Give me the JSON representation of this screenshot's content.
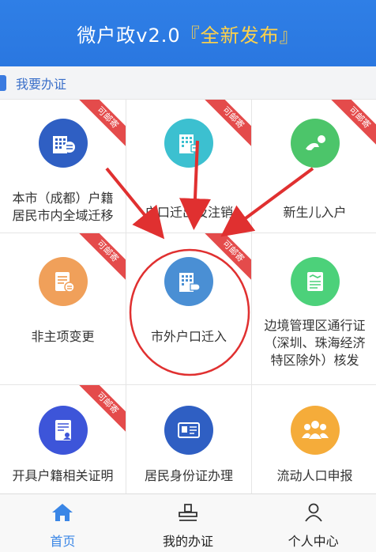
{
  "header": {
    "title_main": "微户政v2.0",
    "title_accent": "『全新发布』"
  },
  "section": {
    "title": "我要办证"
  },
  "services": [
    {
      "label": "本市（成都）户籍居民市内全域迁移",
      "line1": "本市（成都）户籍",
      "line2": "居民市内全域迁移",
      "badge": "可邮寄",
      "icon": "building-transfer-icon",
      "color": "#2f5fc3"
    },
    {
      "label": "户口迁出及注销",
      "badge": "可邮寄",
      "icon": "building-exit-icon",
      "color": "#3cc0d0"
    },
    {
      "label": "新生儿入户",
      "badge": "可邮寄",
      "icon": "baby-crawl-icon",
      "color": "#4cc56a"
    },
    {
      "label": "非主项变更",
      "badge": "可邮寄",
      "icon": "document-edit-icon",
      "color": "#f0a05a"
    },
    {
      "label": "市外户口迁入",
      "badge": "可邮寄",
      "icon": "building-arrive-icon",
      "color": "#4a8fd4"
    },
    {
      "label": "边境管理区通行证（深圳、珠海经济特区除外）核发",
      "line1": "边境管理区通行证",
      "line2": "（深圳、珠海经济",
      "line3": "特区除外）核发",
      "badge": "",
      "icon": "pass-card-icon",
      "color": "#4cd17a"
    },
    {
      "label": "开具户籍相关证明",
      "badge": "可邮寄",
      "icon": "certificate-icon",
      "color": "#3d55d9"
    },
    {
      "label": "居民身份证办理",
      "badge": "",
      "icon": "id-card-icon",
      "color": "#2f5fc3"
    },
    {
      "label": "流动人口申报",
      "badge": "",
      "icon": "people-group-icon",
      "color": "#f5ac3a"
    }
  ],
  "tabs": [
    {
      "label": "首页",
      "icon": "home-icon",
      "active": true
    },
    {
      "label": "我的办证",
      "icon": "stamp-icon",
      "active": false
    },
    {
      "label": "个人中心",
      "icon": "user-icon",
      "active": false
    }
  ],
  "colors": {
    "header_bg": "#2f7fe6",
    "accent_yellow": "#ffd24a",
    "ribbon_red": "#e44b4b",
    "annotation_red": "#e03030",
    "tab_active": "#3a86e6"
  }
}
